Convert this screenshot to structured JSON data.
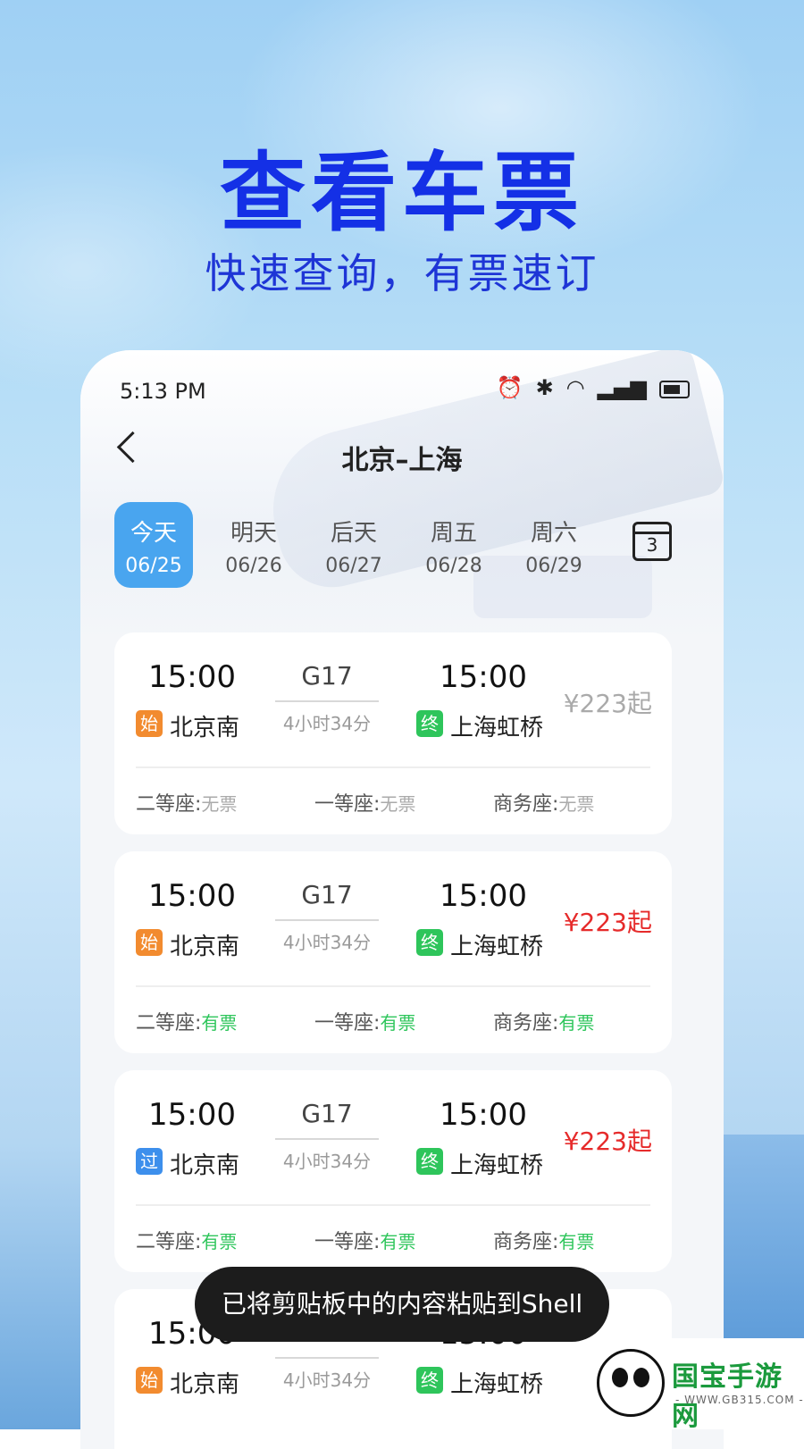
{
  "promo": {
    "title": "查看车票",
    "subtitle": "快速查询，有票速订"
  },
  "status_bar": {
    "time": "5:13 PM",
    "icons": [
      "alarm-icon",
      "bluetooth-icon",
      "wifi-icon",
      "signal-icon",
      "battery-icon"
    ]
  },
  "header": {
    "title": "北京–上海"
  },
  "date_tabs": [
    {
      "label": "今天",
      "date": "06/25",
      "active": true
    },
    {
      "label": "明天",
      "date": "06/26"
    },
    {
      "label": "后天",
      "date": "06/27"
    },
    {
      "label": "周五",
      "date": "06/28"
    },
    {
      "label": "周六",
      "date": "06/29"
    }
  ],
  "calendar_day": "3",
  "trains": [
    {
      "depart_time": "15:00",
      "train_no": "G17",
      "duration": "4小时34分",
      "arrive_time": "15:00",
      "depart_tag": "始",
      "depart_station": "北京南",
      "arrive_tag": "终",
      "arrive_station": "上海虹桥",
      "price": "¥223起",
      "seats": [
        {
          "label": "二等座:",
          "status": "无票"
        },
        {
          "label": "一等座:",
          "status": "无票"
        },
        {
          "label": "商务座:",
          "status": "无票"
        }
      ]
    },
    {
      "depart_time": "15:00",
      "train_no": "G17",
      "duration": "4小时34分",
      "arrive_time": "15:00",
      "depart_tag": "始",
      "depart_station": "北京南",
      "arrive_tag": "终",
      "arrive_station": "上海虹桥",
      "price": "¥223起",
      "seats": [
        {
          "label": "二等座:",
          "status": "有票"
        },
        {
          "label": "一等座:",
          "status": "有票"
        },
        {
          "label": "商务座:",
          "status": "有票"
        }
      ]
    },
    {
      "depart_time": "15:00",
      "train_no": "G17",
      "duration": "4小时34分",
      "arrive_time": "15:00",
      "depart_tag": "过",
      "depart_station": "北京南",
      "arrive_tag": "终",
      "arrive_station": "上海虹桥",
      "price": "¥223起",
      "seats": [
        {
          "label": "二等座:",
          "status": "有票"
        },
        {
          "label": "一等座:",
          "status": "有票"
        },
        {
          "label": "商务座:",
          "status": "有票"
        }
      ]
    },
    {
      "depart_time": "15:00",
      "train_no": "G17",
      "duration": "4小时34分",
      "arrive_time": "15:00",
      "depart_tag": "始",
      "depart_station": "北京南",
      "arrive_tag": "终",
      "arrive_station": "上海虹桥"
    }
  ],
  "toast": "已将剪贴板中的内容粘贴到Shell",
  "watermark": {
    "name": "国宝手游网",
    "url": "- WWW.GB315.COM -"
  },
  "colors": {
    "headline": "#1430e6",
    "active_tab": "#49a5ef",
    "price_red": "#e62b2b",
    "available_green": "#2ec55b",
    "tag_start": "#f28b2f",
    "tag_pass": "#3d8fec",
    "tag_end": "#2ec55b"
  }
}
